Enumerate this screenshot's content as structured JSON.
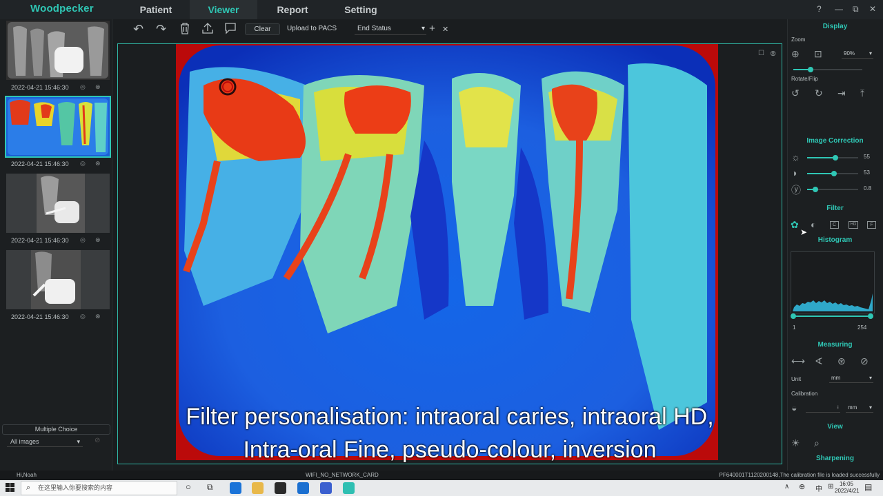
{
  "app": {
    "logo": "Woodpecker"
  },
  "nav": {
    "tabs": [
      {
        "label": "Patient"
      },
      {
        "label": "Viewer"
      },
      {
        "label": "Report"
      },
      {
        "label": "Setting"
      }
    ],
    "active": "Viewer"
  },
  "window": {
    "help": "?",
    "minimize": "—",
    "restore": "⧉",
    "close": "✕"
  },
  "thumbnails": [
    {
      "date": "2022-04-21 15:46:30"
    },
    {
      "date": "2022-04-21 15:46:30"
    },
    {
      "date": "2022-04-21 15:46:30"
    },
    {
      "date": "2022-04-21 15:46:30"
    }
  ],
  "sidebar": {
    "multiple_choice": "Multiple Choice",
    "filter_value": "All images"
  },
  "toolbar": {
    "clear": "Clear",
    "upload": "Upload to PACS",
    "status_value": "End Status",
    "add": "+",
    "remove": "✕"
  },
  "caption": {
    "line1": "Filter personalisation: intraoral caries, intraoral HD,",
    "line2": "Intra-oral Fine, pseudo-colour, inversion"
  },
  "right": {
    "display": "Display",
    "zoom_label": "Zoom",
    "zoom_value": "90%",
    "zoom_level": 0.25,
    "rotate_label": "Rotate/Flip",
    "image_correction": "Image Correction",
    "brightness": {
      "value": "55",
      "level": 0.55
    },
    "contrast": {
      "value": "53",
      "level": 0.53
    },
    "gamma": {
      "value": "0.8",
      "level": 0.16
    },
    "filter": "Filter",
    "filter_buttons": [
      "C",
      "HD",
      "F"
    ],
    "histogram": "Histogram",
    "hist_min": "1",
    "hist_max": "254",
    "measuring": "Measuring",
    "unit_label": "Unit",
    "unit_value": "mm",
    "calibration_label": "Calibration",
    "calibration_unit": "mm",
    "view": "View",
    "sharpening": "Sharpening"
  },
  "status": {
    "user": "Hi,Noah",
    "network": "WIFI_NO_NETWORK_CARD",
    "message": "PF640001T1120200148,The calibration file is loaded successfully"
  },
  "taskbar": {
    "search_placeholder": "在这里输入你要搜索的内容",
    "ime": "中",
    "time": "16:05",
    "date": "2022/4/21"
  },
  "colors": {
    "accent": "#2fc7b5",
    "background": "#1a1d1f"
  }
}
